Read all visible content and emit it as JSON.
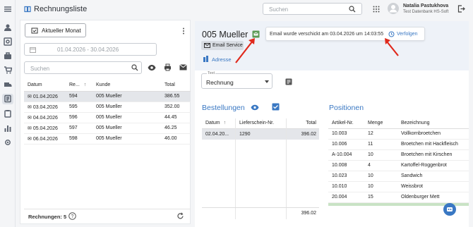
{
  "app": {
    "title": "Rechnungsliste"
  },
  "search": {
    "placeholder": "Suchen"
  },
  "user": {
    "name": "Natalia Pastukhova",
    "company": "Test Datenbank HS-Soft"
  },
  "left": {
    "current_month_label": "Aktueller Monat",
    "date_range": "01.04.2026 - 30.04.2026",
    "search_placeholder": "Suchen",
    "columns": [
      "Datum",
      "Re...",
      "Kunde",
      "Total"
    ],
    "rows": [
      {
        "date": "01.04.2026",
        "nr": "594",
        "customer": "005 Mueller",
        "total": "386.55"
      },
      {
        "date": "03.04.2026",
        "nr": "595",
        "customer": "005 Mueller",
        "total": "352.00"
      },
      {
        "date": "04.04.2026",
        "nr": "596",
        "customer": "005 Mueller",
        "total": "44.45"
      },
      {
        "date": "05.04.2026",
        "nr": "597",
        "customer": "005 Mueller",
        "total": "46.25"
      },
      {
        "date": "06.04.2026",
        "nr": "598",
        "customer": "005 Mueller",
        "total": "46.00"
      }
    ],
    "footer": "Rechnungen: 5"
  },
  "detail": {
    "customer": "005 Mueller",
    "email_service": "Email Service",
    "address": "Adresse",
    "notice": "Email wurde verschickt am 03.04.2026 um 14:03:55",
    "track": "Verfolgen",
    "text_label": "Text",
    "text_value": "Rechnung"
  },
  "orders": {
    "title": "Bestellungen",
    "columns": [
      "Datum",
      "Lieferschein-Nr.",
      "Total"
    ],
    "rows": [
      {
        "date": "02.04.20...",
        "nr": "1290",
        "total": "396.02"
      }
    ],
    "sum": "396.02"
  },
  "positions": {
    "title": "Positionen",
    "columns": [
      "Artikel-Nr.",
      "Menge",
      "Bezeichnung"
    ],
    "rows": [
      {
        "nr": "10.003",
        "qty": "12",
        "desc": "Vollkornbroetchen"
      },
      {
        "nr": "10.006",
        "qty": "11",
        "desc": "Broetchen mit Hackfleisch"
      },
      {
        "nr": "A-10.004",
        "qty": "10",
        "desc": "Broetchen mit Kirschen"
      },
      {
        "nr": "10.008",
        "qty": "4",
        "desc": "Kartoffel-Roggenbrot"
      },
      {
        "nr": "10.023",
        "qty": "10",
        "desc": "Sandwich"
      },
      {
        "nr": "10.010",
        "qty": "10",
        "desc": "Weissbrot"
      },
      {
        "nr": "20.004",
        "qty": "15",
        "desc": "Oldenburger Mett"
      }
    ]
  },
  "colors": {
    "accent": "#3a78c3",
    "arrow": "#e0291c"
  }
}
